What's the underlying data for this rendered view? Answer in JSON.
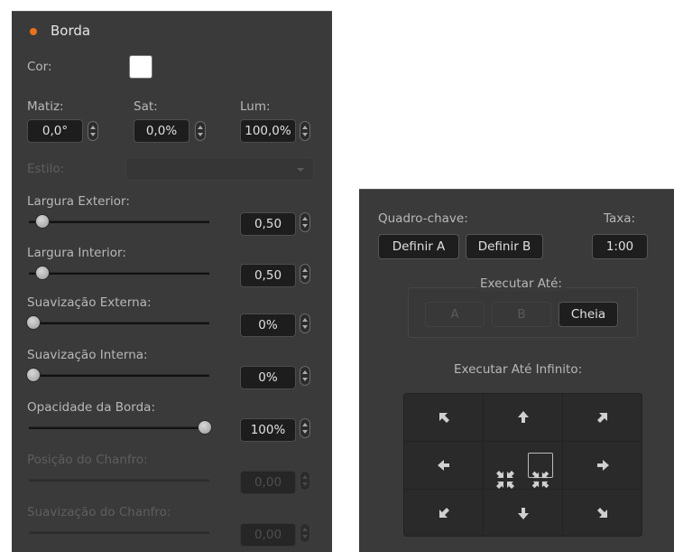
{
  "border_panel": {
    "title": "Borda",
    "color_label": "Cor:",
    "hue": {
      "label": "Matiz:",
      "value": "0,0°"
    },
    "sat": {
      "label": "Sat:",
      "value": "0,0%"
    },
    "lum": {
      "label": "Lum:",
      "value": "100,0%"
    },
    "style_label": "Estilo:",
    "style_value": "",
    "sliders": [
      {
        "label": "Largura Exterior:",
        "value": "0,50",
        "level": 0.05,
        "enabled": true
      },
      {
        "label": "Largura Interior:",
        "value": "0,50",
        "level": 0.05,
        "enabled": true
      },
      {
        "label": "Suavização Externa:",
        "value": "0%",
        "level": 0.0,
        "enabled": true
      },
      {
        "label": "Suavização Interna:",
        "value": "0%",
        "level": 0.0,
        "enabled": true
      },
      {
        "label": "Opacidade da Borda:",
        "value": "100%",
        "level": 1.0,
        "enabled": true
      },
      {
        "label": "Posição do Chanfro:",
        "value": "0,00",
        "level": null,
        "enabled": false
      },
      {
        "label": "Suavização do Chanfro:",
        "value": "0,00",
        "level": null,
        "enabled": false
      }
    ]
  },
  "keyframe_panel": {
    "keyframe_label": "Quadro-chave:",
    "set_a": "Definir A",
    "set_b": "Definir B",
    "rate_label": "Taxa:",
    "rate_value": "1:00",
    "run_to_label": "Executar Até:",
    "run_a": "A",
    "run_b": "B",
    "run_full": "Cheia",
    "run_infinity_label": "Executar Até Infinito:"
  },
  "colors": {
    "panel_bg": "#3a3a3a",
    "accent_dot": "#e8721c",
    "swatch": "#ffffff"
  },
  "icons": {
    "grid": [
      "arrow-up-left-icon",
      "arrow-up-icon",
      "arrow-up-right-icon",
      "arrow-left-icon",
      "center-in-icon",
      "arrow-right-icon",
      "arrow-down-left-icon",
      "arrow-down-icon",
      "arrow-down-right-icon"
    ]
  }
}
